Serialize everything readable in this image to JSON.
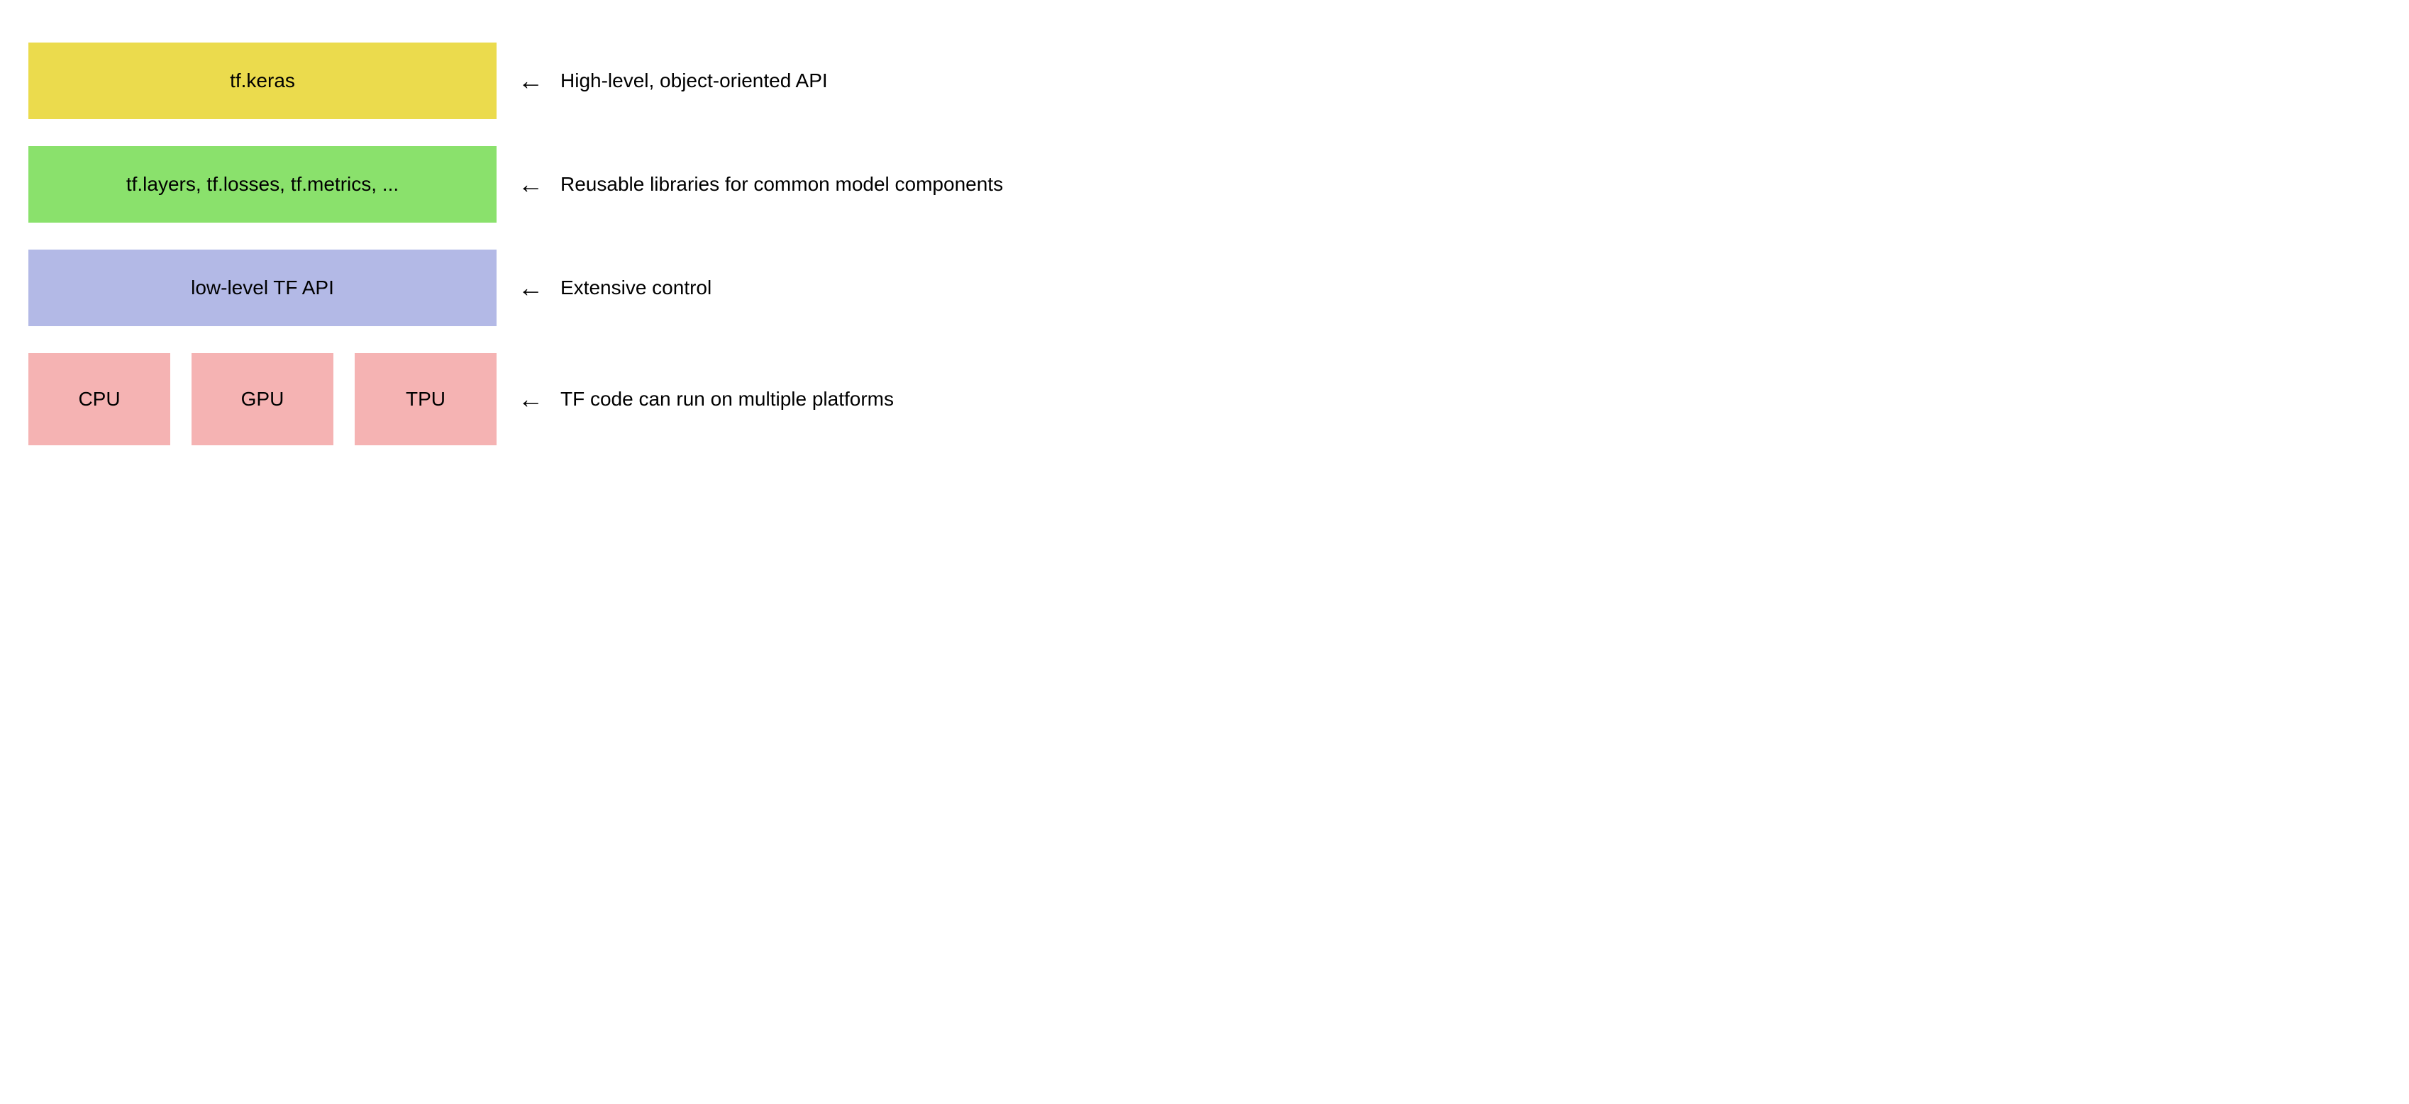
{
  "layers": [
    {
      "label": "tf.keras",
      "color": "yellow",
      "description": "High-level, object-oriented API"
    },
    {
      "label": "tf.layers, tf.losses, tf.metrics, ...",
      "color": "green",
      "description": "Reusable libraries for common model components"
    },
    {
      "label": "low-level TF API",
      "color": "blue",
      "description": "Extensive control"
    }
  ],
  "hardware": {
    "items": [
      "CPU",
      "GPU",
      "TPU"
    ],
    "description": "TF code can run on multiple platforms"
  },
  "arrow_glyph": "←"
}
